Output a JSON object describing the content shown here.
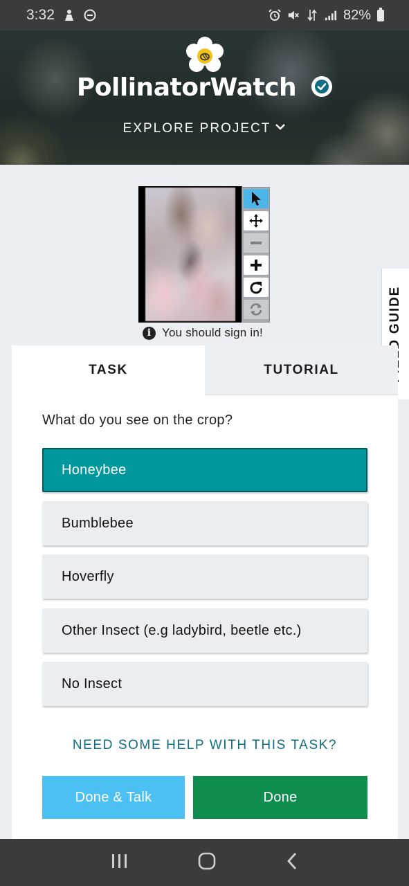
{
  "status_bar": {
    "time": "3:32",
    "battery_percent": "82%",
    "icons": [
      "person-icon",
      "dnd-icon",
      "alarm-icon",
      "mute-icon",
      "data-icon",
      "signal-icon",
      "battery-icon"
    ]
  },
  "header": {
    "project_name": "PollinatorWatch",
    "explore_label": "EXPLORE PROJECT",
    "verified": true
  },
  "viewer": {
    "tools": [
      "pointer-icon",
      "move-icon",
      "zoom-out-icon",
      "zoom-in-icon",
      "rotate-icon",
      "reset-icon"
    ],
    "active_tool": "pointer-icon",
    "signin_notice": "You should sign in!"
  },
  "field_guide_label": "FIELD GUIDE",
  "tabs": [
    {
      "label": "TASK",
      "active": true
    },
    {
      "label": "TUTORIAL",
      "active": false
    }
  ],
  "task": {
    "question": "What do you see on the crop?",
    "answers": [
      {
        "label": "Honeybee",
        "selected": true
      },
      {
        "label": "Bumblebee",
        "selected": false
      },
      {
        "label": "Hoverfly",
        "selected": false
      },
      {
        "label": "Other Insect (e.g ladybird, beetle etc.)",
        "selected": false
      },
      {
        "label": "No Insect",
        "selected": false
      }
    ],
    "help_link": "NEED SOME HELP WITH THIS TASK?",
    "done_talk_label": "Done & Talk",
    "done_label": "Done"
  },
  "colors": {
    "selected_answer": "#00979d",
    "done_talk": "#4cc0f2",
    "done": "#0f8d4f",
    "help_link": "#0e6c85"
  }
}
